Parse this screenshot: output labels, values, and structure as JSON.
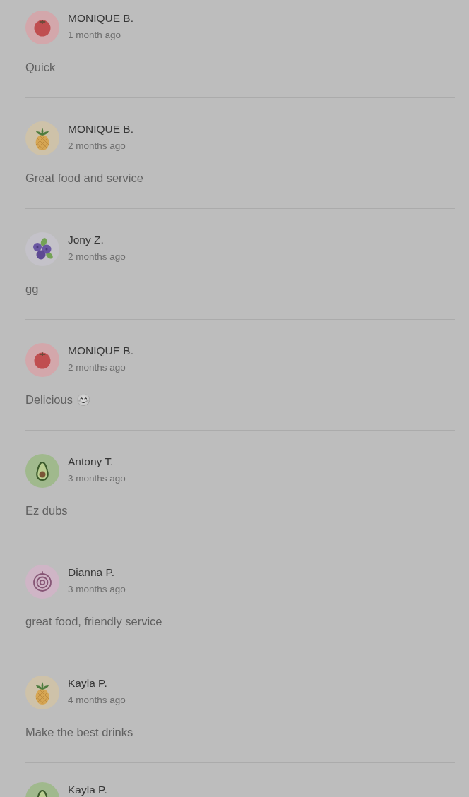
{
  "reviews": [
    {
      "kind": "tomato",
      "name": "MONIQUE B.",
      "time": "1 month ago",
      "comment": "Quick"
    },
    {
      "kind": "pineapple",
      "name": "MONIQUE B.",
      "time": "2 months ago",
      "comment": "Great food and service"
    },
    {
      "kind": "blueberries",
      "name": "Jony Z.",
      "time": "2 months ago",
      "comment": "gg"
    },
    {
      "kind": "tomato",
      "name": "MONIQUE B.",
      "time": "2 months ago",
      "comment": "Delicious 😊"
    },
    {
      "kind": "avocado",
      "name": "Antony T.",
      "time": "3 months ago",
      "comment": "Ez dubs"
    },
    {
      "kind": "onion",
      "name": "Dianna P.",
      "time": "3 months ago",
      "comment": "great food, friendly service"
    },
    {
      "kind": "pineapple",
      "name": "Kayla P.",
      "time": "4 months ago",
      "comment": "Make the best drinks"
    },
    {
      "kind": "avocado",
      "name": "Kayla P."
    }
  ]
}
